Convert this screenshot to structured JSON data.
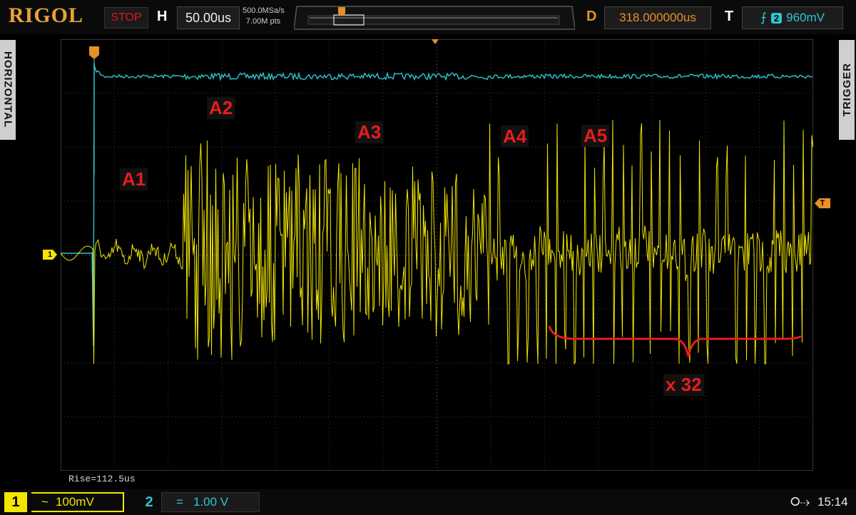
{
  "brand": "RIGOL",
  "status": "STOP",
  "horizontal": {
    "label": "H",
    "timebase": "50.00us",
    "sample_rate": "500.0MSa/s",
    "memory_depth": "7.00M pts"
  },
  "delay": {
    "label": "D",
    "value": "318.000000us"
  },
  "trigger": {
    "label": "T",
    "source": "2",
    "level": "960mV"
  },
  "side_tabs": {
    "left": "HORIZONTAL",
    "right": "TRIGGER"
  },
  "measurement": "Rise=112.5us",
  "annotations": {
    "labels": [
      "A1",
      "A2",
      "A3",
      "A4",
      "A5"
    ],
    "count_label": "x 32"
  },
  "channels": [
    {
      "number": "1",
      "coupling": "~",
      "scale": "100mV",
      "color": "#f2e600"
    },
    {
      "number": "2",
      "coupling": "=",
      "scale": "1.00 V",
      "color": "#2fc6d0"
    }
  ],
  "ch1_marker": "1",
  "trigger_marker": "T",
  "clock": "15:14",
  "colors": {
    "ch1": "#f2e600",
    "ch2": "#2fc6d0",
    "delay": "#e8902a",
    "annotation": "#e81c1c"
  }
}
